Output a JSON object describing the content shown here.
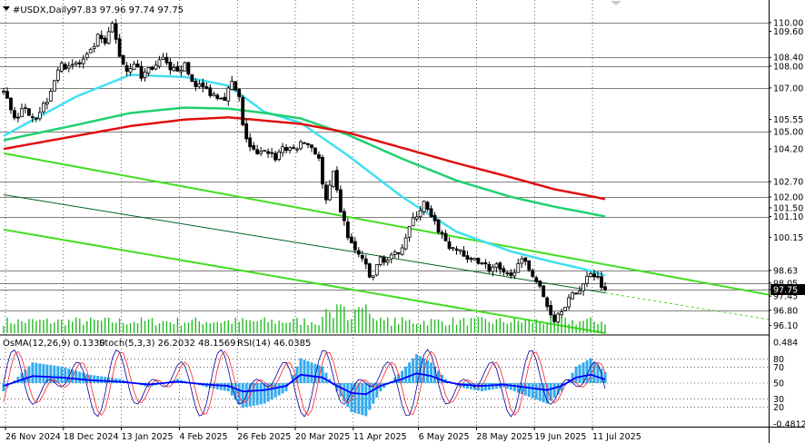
{
  "header": {
    "symbol": "#USDX,Daily",
    "ohlc": "97.83 97.96 97.74 97.75"
  },
  "indicator_header": {
    "osma": "OsMA(12,26,9) 0.1330",
    "stoch": "Stoch(5,3,3) 26.2032 48.1569",
    "rsi": "RSI(14) 46.0385"
  },
  "colors": {
    "background": "#ffffff",
    "grid": "#000000",
    "candles": "#000000",
    "ema_fast": "#40e0f0",
    "ema_mid": "#20d070",
    "ema_slow": "#e01010",
    "channel": "#44dd22",
    "channel_mid": "#006020",
    "volume": "#22bb22",
    "osma": "#33aaee",
    "stoch_main": "#0000a0",
    "stoch_signal": "#ff2020",
    "rsi": "#0000ff"
  },
  "chart_data": {
    "type": "candlestick",
    "timeframe": "Daily",
    "price_axis": {
      "ylim": [
        95.75,
        110.45
      ],
      "tick_labels": [
        "110.00",
        "109.60",
        "108.40",
        "108.00",
        "107.00",
        "105.55",
        "105.00",
        "104.20",
        "102.70",
        "102.00",
        "101.50",
        "101.10",
        "100.15",
        "98.63",
        "98.05",
        "97.75",
        "97.45",
        "96.80",
        "96.10"
      ],
      "levels": [
        110.0,
        108.4,
        108.0,
        107.0,
        105.0,
        102.7,
        102.0,
        101.1,
        98.63,
        98.05,
        97.75,
        96.8
      ]
    },
    "current_price": 97.75,
    "x_axis": {
      "labels": [
        "26 Nov 2024",
        "18 Dec 2024",
        "13 Jan 2025",
        "4 Feb 2025",
        "26 Feb 2025",
        "20 Mar 2025",
        "11 Apr 2025",
        "6 May 2025",
        "28 May 2025",
        "19 Jun 2025",
        "11 Jul 2025"
      ],
      "label_bar_index": [
        0,
        16,
        32,
        48,
        64,
        80,
        96,
        114,
        130,
        146,
        162
      ]
    },
    "price_keypoints": [
      [
        0,
        106.8
      ],
      [
        3,
        105.7
      ],
      [
        6,
        106.0
      ],
      [
        9,
        105.7
      ],
      [
        12,
        106.5
      ],
      [
        15,
        107.9
      ],
      [
        18,
        108.1
      ],
      [
        21,
        108.1
      ],
      [
        24,
        108.6
      ],
      [
        26,
        109.3
      ],
      [
        28,
        109.0
      ],
      [
        30,
        109.9
      ],
      [
        32,
        108.5
      ],
      [
        34,
        107.8
      ],
      [
        36,
        108.2
      ],
      [
        38,
        107.5
      ],
      [
        40,
        107.9
      ],
      [
        42,
        108.0
      ],
      [
        44,
        108.3
      ],
      [
        46,
        107.7
      ],
      [
        48,
        107.9
      ],
      [
        50,
        108.0
      ],
      [
        52,
        107.3
      ],
      [
        55,
        107.0
      ],
      [
        58,
        106.7
      ],
      [
        61,
        106.6
      ],
      [
        63,
        107.2
      ],
      [
        65,
        106.5
      ],
      [
        66,
        105.2
      ],
      [
        68,
        104.3
      ],
      [
        70,
        103.9
      ],
      [
        73,
        104.1
      ],
      [
        75,
        103.8
      ],
      [
        77,
        104.3
      ],
      [
        79,
        104.1
      ],
      [
        81,
        104.3
      ],
      [
        83,
        104.5
      ],
      [
        85,
        104.3
      ],
      [
        87,
        103.8
      ],
      [
        88,
        102.5
      ],
      [
        89,
        101.8
      ],
      [
        91,
        103.0
      ],
      [
        93,
        101.4
      ],
      [
        95,
        100.2
      ],
      [
        97,
        99.5
      ],
      [
        99,
        99.2
      ],
      [
        101,
        98.3
      ],
      [
        102,
        98.4
      ],
      [
        104,
        99.2
      ],
      [
        106,
        99.1
      ],
      [
        108,
        99.3
      ],
      [
        110,
        99.8
      ],
      [
        112,
        100.6
      ],
      [
        114,
        101.2
      ],
      [
        116,
        101.7
      ],
      [
        118,
        101.0
      ],
      [
        120,
        100.5
      ],
      [
        122,
        100.0
      ],
      [
        124,
        99.5
      ],
      [
        126,
        99.6
      ],
      [
        128,
        99.0
      ],
      [
        130,
        99.2
      ],
      [
        132,
        99.0
      ],
      [
        134,
        98.7
      ],
      [
        136,
        98.8
      ],
      [
        138,
        98.4
      ],
      [
        140,
        98.3
      ],
      [
        142,
        99.1
      ],
      [
        144,
        98.9
      ],
      [
        146,
        98.5
      ],
      [
        148,
        97.8
      ],
      [
        150,
        97.0
      ],
      [
        152,
        96.4
      ],
      [
        154,
        96.9
      ],
      [
        156,
        97.3
      ],
      [
        158,
        97.6
      ],
      [
        160,
        98.0
      ],
      [
        162,
        98.6
      ],
      [
        164,
        98.3
      ],
      [
        166,
        97.75
      ]
    ],
    "series": [
      {
        "name": "",
        "kind": "ema_fast",
        "points": [
          [
            0,
            104.8
          ],
          [
            20,
            106.6
          ],
          [
            35,
            107.6
          ],
          [
            50,
            107.5
          ],
          [
            62,
            107.1
          ],
          [
            72,
            105.9
          ],
          [
            82,
            105.4
          ],
          [
            95,
            103.9
          ],
          [
            110,
            102.0
          ],
          [
            125,
            100.4
          ],
          [
            140,
            99.5
          ],
          [
            152,
            99.0
          ],
          [
            160,
            98.7
          ],
          [
            166,
            98.4
          ]
        ]
      },
      {
        "name": "",
        "kind": "ema_mid",
        "points": [
          [
            0,
            104.6
          ],
          [
            20,
            105.3
          ],
          [
            35,
            105.85
          ],
          [
            50,
            106.1
          ],
          [
            62,
            106.05
          ],
          [
            72,
            105.85
          ],
          [
            82,
            105.6
          ],
          [
            95,
            104.85
          ],
          [
            110,
            103.75
          ],
          [
            125,
            102.75
          ],
          [
            140,
            102.0
          ],
          [
            152,
            101.55
          ],
          [
            160,
            101.3
          ],
          [
            166,
            101.1
          ]
        ]
      },
      {
        "name": "",
        "kind": "ema_slow",
        "points": [
          [
            0,
            104.2
          ],
          [
            20,
            104.8
          ],
          [
            35,
            105.25
          ],
          [
            50,
            105.55
          ],
          [
            62,
            105.65
          ],
          [
            72,
            105.5
          ],
          [
            82,
            105.35
          ],
          [
            95,
            104.95
          ],
          [
            110,
            104.25
          ],
          [
            125,
            103.55
          ],
          [
            140,
            102.9
          ],
          [
            152,
            102.35
          ],
          [
            160,
            102.1
          ],
          [
            166,
            101.9
          ]
        ]
      }
    ],
    "channel_lines": [
      {
        "kind": "upper",
        "from": [
          0,
          104.0
        ],
        "to": [
          166,
          98.9
        ]
      },
      {
        "kind": "middle",
        "from": [
          0,
          102.1
        ],
        "to": [
          166,
          97.6
        ]
      },
      {
        "kind": "lower",
        "from": [
          0,
          100.5
        ],
        "to": [
          166,
          95.75
        ]
      }
    ],
    "oscillator_axis": {
      "tick_labels": [
        "0.484",
        "80",
        "70",
        "50",
        "30",
        "20",
        "-0.4812"
      ]
    },
    "oscillators": {
      "osma_current": 0.133,
      "stoch_main_current": 26.2032,
      "stoch_signal_current": 48.1569,
      "rsi_current": 46.0385
    }
  }
}
